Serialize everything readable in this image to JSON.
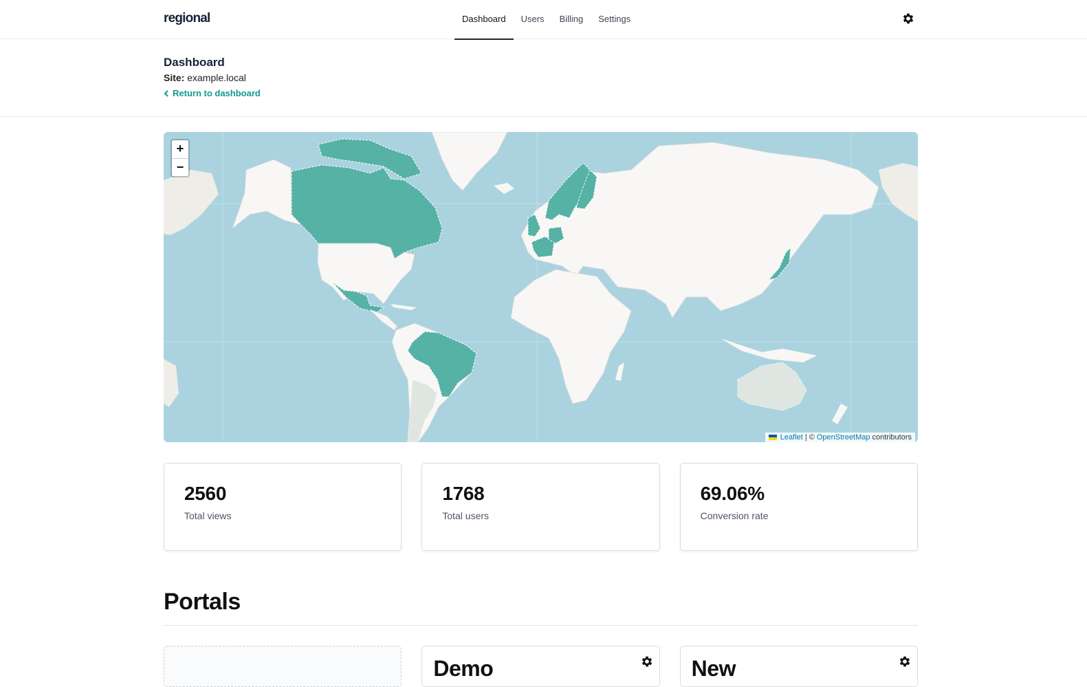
{
  "app": {
    "logo": "regional"
  },
  "nav": {
    "items": [
      {
        "label": "Dashboard",
        "active": true
      },
      {
        "label": "Users",
        "active": false
      },
      {
        "label": "Billing",
        "active": false
      },
      {
        "label": "Settings",
        "active": false
      }
    ],
    "settings_icon": "gear-icon"
  },
  "header": {
    "title": "Dashboard",
    "site_label": "Site:",
    "site_value": "example.local",
    "back_link": "Return to dashboard",
    "back_icon": "chevron-left-icon"
  },
  "map": {
    "zoom_in": "+",
    "zoom_out": "−",
    "attribution": {
      "leaflet": "Leaflet",
      "separator": "| ©",
      "osm": "OpenStreetMap",
      "suffix": "contributors"
    },
    "colors": {
      "water": "#aad3df",
      "land": "#f8f7f5",
      "highlight": "#55b2a5",
      "dim": "#dfe5e0"
    },
    "highlighted_countries": [
      "Canada",
      "Mexico",
      "Brazil",
      "United Kingdom",
      "France",
      "Germany",
      "Norway",
      "Sweden",
      "Finland",
      "Japan",
      "Greenland islands"
    ]
  },
  "stats": [
    {
      "value": "2560",
      "label": "Total views"
    },
    {
      "value": "1768",
      "label": "Total users"
    },
    {
      "value": "69.06%",
      "label": "Conversion rate"
    }
  ],
  "portals": {
    "title": "Portals",
    "cards": [
      {
        "name": "",
        "type": "add"
      },
      {
        "name": "Demo",
        "settings_icon": "gear-icon"
      },
      {
        "name": "New",
        "settings_icon": "gear-icon"
      }
    ]
  }
}
